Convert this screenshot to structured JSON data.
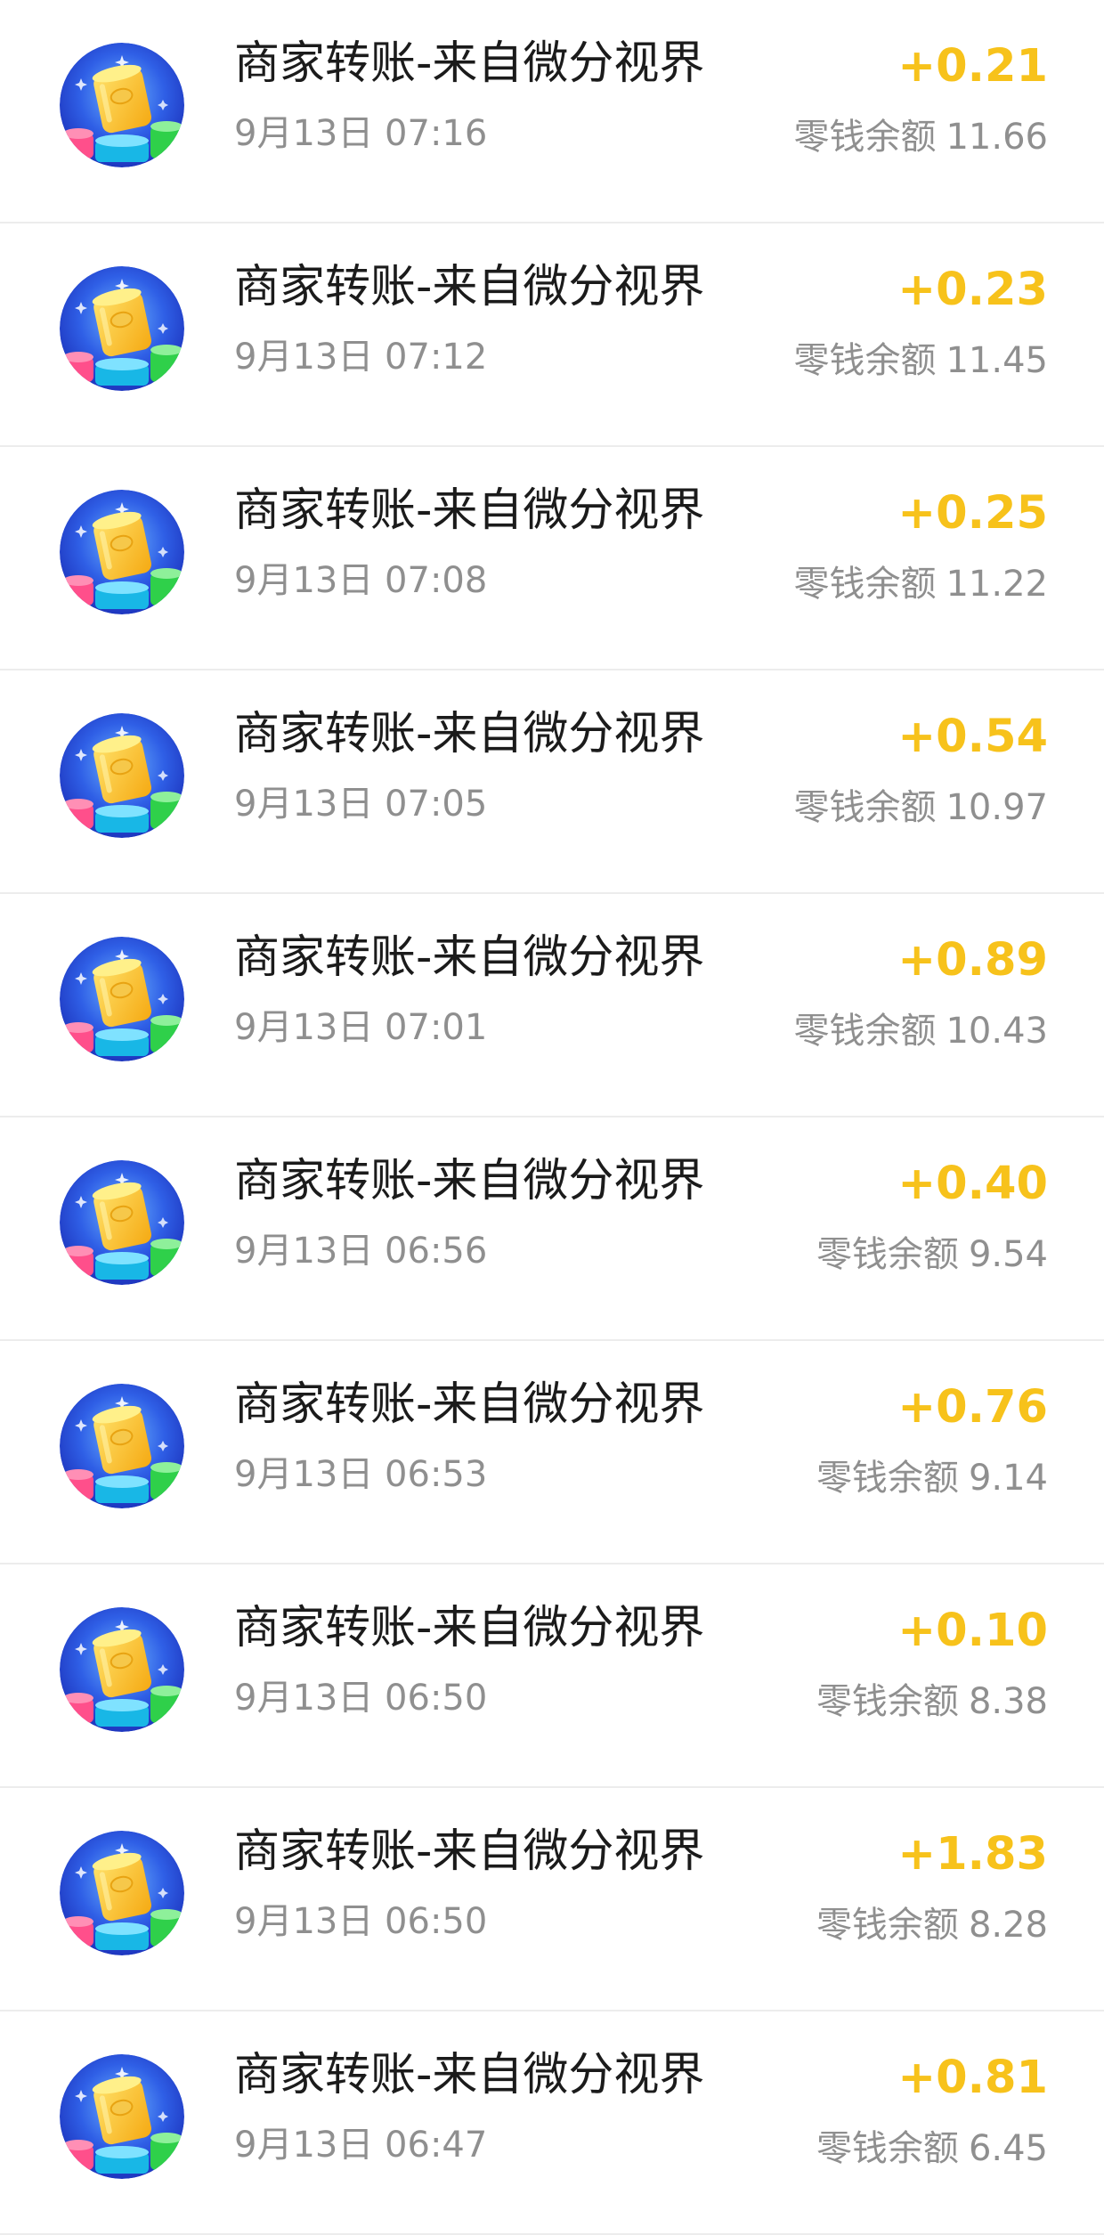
{
  "transactions": [
    {
      "title": "商家转账-来自微分视界",
      "time": "9月13日 07:16",
      "amount": "+0.21",
      "balance_label": "零钱余额",
      "balance": "11.66"
    },
    {
      "title": "商家转账-来自微分视界",
      "time": "9月13日 07:12",
      "amount": "+0.23",
      "balance_label": "零钱余额",
      "balance": "11.45"
    },
    {
      "title": "商家转账-来自微分视界",
      "time": "9月13日 07:08",
      "amount": "+0.25",
      "balance_label": "零钱余额",
      "balance": "11.22"
    },
    {
      "title": "商家转账-来自微分视界",
      "time": "9月13日 07:05",
      "amount": "+0.54",
      "balance_label": "零钱余额",
      "balance": "10.97"
    },
    {
      "title": "商家转账-来自微分视界",
      "time": "9月13日 07:01",
      "amount": "+0.89",
      "balance_label": "零钱余额",
      "balance": "10.43"
    },
    {
      "title": "商家转账-来自微分视界",
      "time": "9月13日 06:56",
      "amount": "+0.40",
      "balance_label": "零钱余额",
      "balance": "9.54"
    },
    {
      "title": "商家转账-来自微分视界",
      "time": "9月13日 06:53",
      "amount": "+0.76",
      "balance_label": "零钱余额",
      "balance": "9.14"
    },
    {
      "title": "商家转账-来自微分视界",
      "time": "9月13日 06:50",
      "amount": "+0.10",
      "balance_label": "零钱余额",
      "balance": "8.38"
    },
    {
      "title": "商家转账-来自微分视界",
      "time": "9月13日 06:50",
      "amount": "+1.83",
      "balance_label": "零钱余额",
      "balance": "8.28"
    },
    {
      "title": "商家转账-来自微分视界",
      "time": "9月13日 06:47",
      "amount": "+0.81",
      "balance_label": "零钱余额",
      "balance": "6.45"
    }
  ],
  "avatar_icon": "merchant-game-icon",
  "colors": {
    "amount": "#f7c21b",
    "secondary_text": "#8f8f8f",
    "primary_text": "#1b1b1b",
    "divider": "#ececec"
  }
}
